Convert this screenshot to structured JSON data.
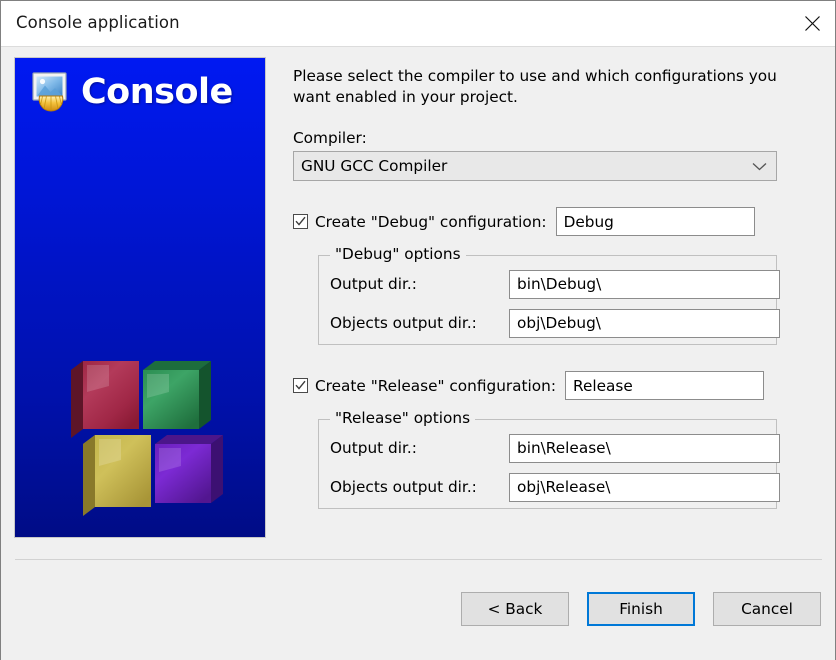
{
  "window": {
    "title": "Console application",
    "close_icon": "close-icon"
  },
  "logo_panel": {
    "app_name": "Console",
    "icon": "console-app-icon",
    "cubes_icon": "codeblocks-cubes-icon",
    "background_top_color": "#0019f2",
    "background_bottom_color": "#000c86",
    "cube_colors": {
      "top_left": "#a8294a",
      "top_right": "#2e9455",
      "bottom_left": "#bdb048",
      "bottom_right": "#6b20bd"
    }
  },
  "form": {
    "intro": "Please select the compiler to use and which configurations you want enabled in your project.",
    "compiler_label": "Compiler:",
    "compiler_value": "GNU GCC Compiler",
    "compiler_arrow_icon": "chevron-down-icon",
    "debug": {
      "checkbox_label": "Create \"Debug\" configuration:",
      "checked": true,
      "name_value": "Debug",
      "group_legend": "\"Debug\" options",
      "output_dir_label": "Output dir.:",
      "output_dir_value": "bin\\Debug\\",
      "objects_dir_label": "Objects output dir.:",
      "objects_dir_value": "obj\\Debug\\"
    },
    "release": {
      "checkbox_label": "Create \"Release\" configuration:",
      "checked": true,
      "name_value": "Release",
      "group_legend": "\"Release\" options",
      "output_dir_label": "Output dir.:",
      "output_dir_value": "bin\\Release\\",
      "objects_dir_label": "Objects output dir.:",
      "objects_dir_value": "obj\\Release\\"
    }
  },
  "footer": {
    "back_label": "< Back",
    "finish_label": "Finish",
    "cancel_label": "Cancel",
    "default_button": "Finish",
    "focus_color": "#0078d7"
  }
}
